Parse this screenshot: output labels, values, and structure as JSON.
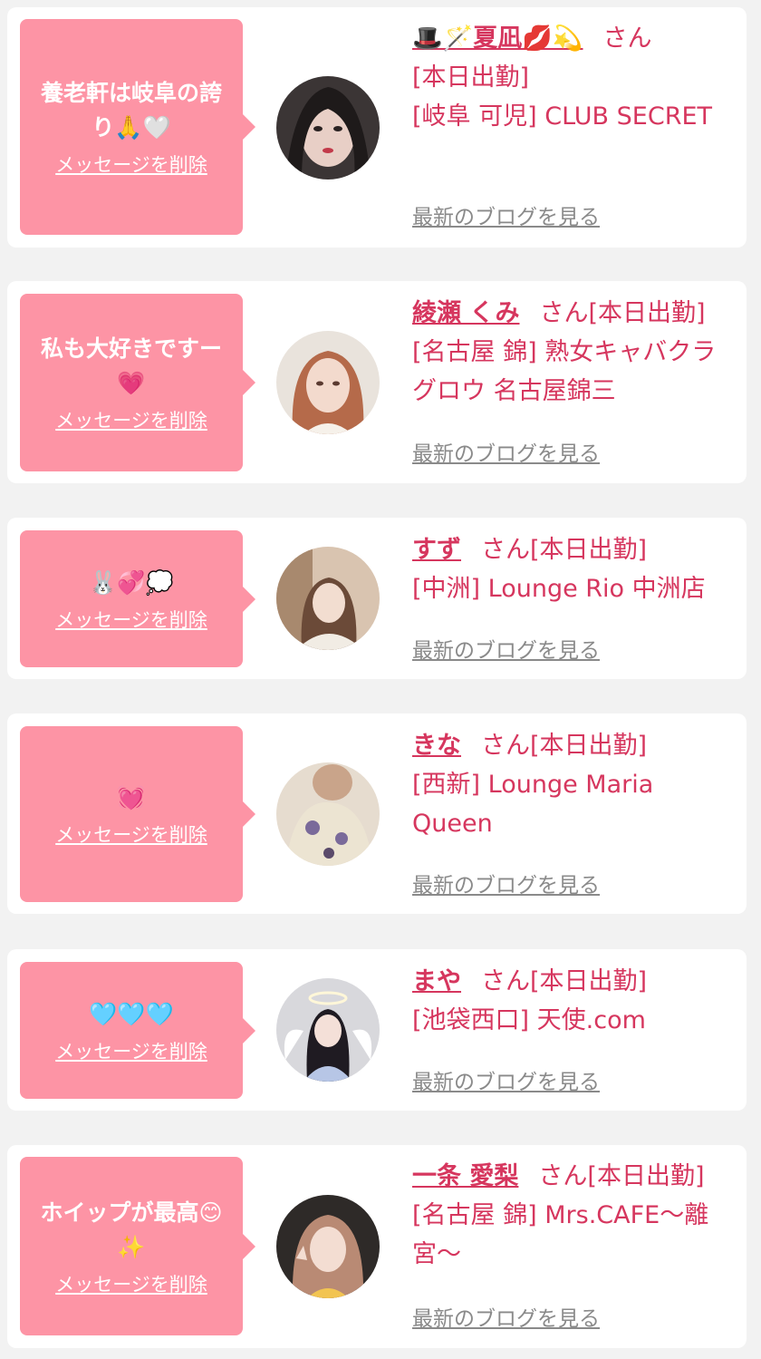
{
  "delete_label": "メッセージを削除",
  "blog_label": "最新のブログを見る",
  "san_label": "さん",
  "colors": {
    "bubble": "#fd94a5",
    "accent": "#d6365e",
    "link_gray": "#8a8a8a",
    "background": "#f2f2f2"
  },
  "items": [
    {
      "message": "養老軒は岐阜の誇り🙏🤍",
      "name": "🎩🪄夏凪💋💫",
      "san": "さん",
      "status": "[本日出勤]",
      "shop": "[岐阜 可児] CLUB SECRET"
    },
    {
      "message": "私も大好きですー💗",
      "name": "綾瀬 くみ",
      "san": "さん",
      "status": "[本日出勤]",
      "shop": "[名古屋 錦] 熟女キャバクラグロウ 名古屋錦三"
    },
    {
      "message": "🐰💞💭",
      "name": "すず",
      "san": "さん",
      "status": "[本日出勤]",
      "shop": "[中洲] Lounge Rio 中洲店"
    },
    {
      "message": "💓",
      "name": "きな",
      "san": "さん",
      "status": "[本日出勤]",
      "shop": "[西新] Lounge Maria Queen"
    },
    {
      "message": "🩵🩵🩵",
      "name": "まや",
      "san": "さん",
      "status": "[本日出勤]",
      "shop": "[池袋西口] 天使.com"
    },
    {
      "message": "ホイップが最高😊✨",
      "name": "一条 愛梨",
      "san": "さん",
      "status": "[本日出勤]",
      "shop": "[名古屋 錦] Mrs.CAFE〜離宮〜"
    }
  ]
}
